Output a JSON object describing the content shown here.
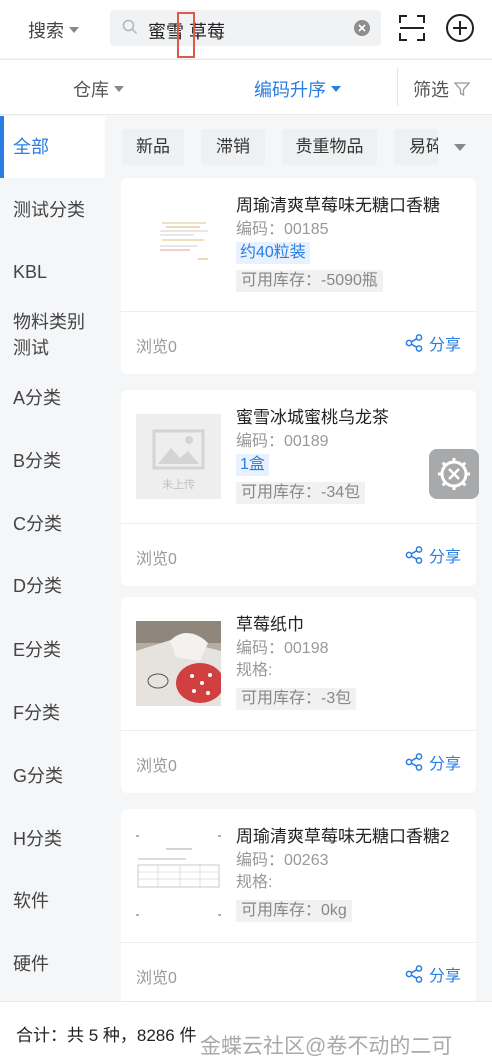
{
  "search": {
    "scope_label": "搜索",
    "query": "蜜雪 草莓"
  },
  "filters": {
    "warehouse": "仓库",
    "sort": "编码升序",
    "filter": "筛选"
  },
  "sidebar": {
    "items": [
      {
        "label": "全部",
        "active": true
      },
      {
        "label": "测试分类"
      },
      {
        "label": "KBL"
      },
      {
        "label": "物料类别测试"
      },
      {
        "label": "A分类"
      },
      {
        "label": "B分类"
      },
      {
        "label": "C分类"
      },
      {
        "label": "D分类"
      },
      {
        "label": "E分类"
      },
      {
        "label": "F分类"
      },
      {
        "label": "G分类"
      },
      {
        "label": "H分类"
      },
      {
        "label": "软件"
      },
      {
        "label": "硬件"
      }
    ]
  },
  "tags": [
    "新品",
    "滞销",
    "贵重物品",
    "易碎"
  ],
  "products": [
    {
      "name": "周瑜清爽草莓味无糖口香糖",
      "code": "编码：00185",
      "spec": "约40粒装",
      "stock": "可用库存：-5090瓶",
      "views": "浏览0",
      "share": "分享",
      "thumb": "doc-note"
    },
    {
      "name": "蜜雪冰城蜜桃乌龙茶",
      "code": "编码：00189",
      "spec": "1盒",
      "stock": "可用库存：-34包",
      "views": "浏览0",
      "share": "分享",
      "thumb": "placeholder",
      "placeholder_text": "未上传"
    },
    {
      "name": "草莓纸巾",
      "code": "编码：00198",
      "spec_label": "规格:",
      "stock": "可用库存：-3包",
      "views": "浏览0",
      "share": "分享",
      "thumb": "tissue-photo"
    },
    {
      "name": "周瑜清爽草莓味无糖口香糖2",
      "code": "编码：00263",
      "spec_label": "规格:",
      "stock": "可用库存：0kg",
      "views": "浏览0",
      "share": "分享",
      "thumb": "doc-table"
    }
  ],
  "footer": {
    "total": "合计：共 5 种，8286 件",
    "watermark": "金蝶云社区@卷不动的二可"
  },
  "colors": {
    "accent": "#2a7de1",
    "highlight_box": "#e0574c"
  }
}
